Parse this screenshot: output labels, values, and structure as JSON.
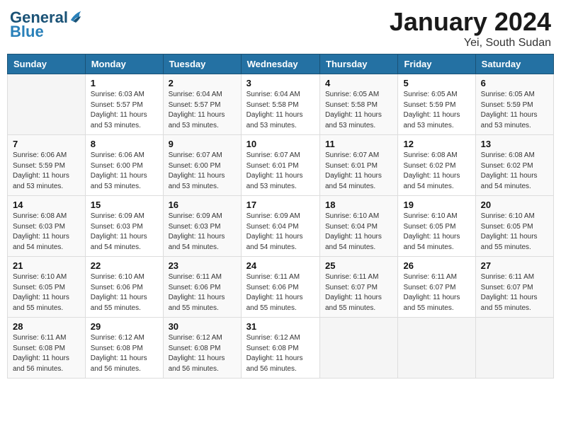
{
  "header": {
    "logo_line1": "General",
    "logo_line2": "Blue",
    "month": "January 2024",
    "location": "Yei, South Sudan"
  },
  "weekdays": [
    "Sunday",
    "Monday",
    "Tuesday",
    "Wednesday",
    "Thursday",
    "Friday",
    "Saturday"
  ],
  "weeks": [
    [
      {
        "day": "",
        "info": ""
      },
      {
        "day": "1",
        "info": "Sunrise: 6:03 AM\nSunset: 5:57 PM\nDaylight: 11 hours\nand 53 minutes."
      },
      {
        "day": "2",
        "info": "Sunrise: 6:04 AM\nSunset: 5:57 PM\nDaylight: 11 hours\nand 53 minutes."
      },
      {
        "day": "3",
        "info": "Sunrise: 6:04 AM\nSunset: 5:58 PM\nDaylight: 11 hours\nand 53 minutes."
      },
      {
        "day": "4",
        "info": "Sunrise: 6:05 AM\nSunset: 5:58 PM\nDaylight: 11 hours\nand 53 minutes."
      },
      {
        "day": "5",
        "info": "Sunrise: 6:05 AM\nSunset: 5:59 PM\nDaylight: 11 hours\nand 53 minutes."
      },
      {
        "day": "6",
        "info": "Sunrise: 6:05 AM\nSunset: 5:59 PM\nDaylight: 11 hours\nand 53 minutes."
      }
    ],
    [
      {
        "day": "7",
        "info": "Sunrise: 6:06 AM\nSunset: 5:59 PM\nDaylight: 11 hours\nand 53 minutes."
      },
      {
        "day": "8",
        "info": "Sunrise: 6:06 AM\nSunset: 6:00 PM\nDaylight: 11 hours\nand 53 minutes."
      },
      {
        "day": "9",
        "info": "Sunrise: 6:07 AM\nSunset: 6:00 PM\nDaylight: 11 hours\nand 53 minutes."
      },
      {
        "day": "10",
        "info": "Sunrise: 6:07 AM\nSunset: 6:01 PM\nDaylight: 11 hours\nand 53 minutes."
      },
      {
        "day": "11",
        "info": "Sunrise: 6:07 AM\nSunset: 6:01 PM\nDaylight: 11 hours\nand 54 minutes."
      },
      {
        "day": "12",
        "info": "Sunrise: 6:08 AM\nSunset: 6:02 PM\nDaylight: 11 hours\nand 54 minutes."
      },
      {
        "day": "13",
        "info": "Sunrise: 6:08 AM\nSunset: 6:02 PM\nDaylight: 11 hours\nand 54 minutes."
      }
    ],
    [
      {
        "day": "14",
        "info": "Sunrise: 6:08 AM\nSunset: 6:03 PM\nDaylight: 11 hours\nand 54 minutes."
      },
      {
        "day": "15",
        "info": "Sunrise: 6:09 AM\nSunset: 6:03 PM\nDaylight: 11 hours\nand 54 minutes."
      },
      {
        "day": "16",
        "info": "Sunrise: 6:09 AM\nSunset: 6:03 PM\nDaylight: 11 hours\nand 54 minutes."
      },
      {
        "day": "17",
        "info": "Sunrise: 6:09 AM\nSunset: 6:04 PM\nDaylight: 11 hours\nand 54 minutes."
      },
      {
        "day": "18",
        "info": "Sunrise: 6:10 AM\nSunset: 6:04 PM\nDaylight: 11 hours\nand 54 minutes."
      },
      {
        "day": "19",
        "info": "Sunrise: 6:10 AM\nSunset: 6:05 PM\nDaylight: 11 hours\nand 54 minutes."
      },
      {
        "day": "20",
        "info": "Sunrise: 6:10 AM\nSunset: 6:05 PM\nDaylight: 11 hours\nand 55 minutes."
      }
    ],
    [
      {
        "day": "21",
        "info": "Sunrise: 6:10 AM\nSunset: 6:05 PM\nDaylight: 11 hours\nand 55 minutes."
      },
      {
        "day": "22",
        "info": "Sunrise: 6:10 AM\nSunset: 6:06 PM\nDaylight: 11 hours\nand 55 minutes."
      },
      {
        "day": "23",
        "info": "Sunrise: 6:11 AM\nSunset: 6:06 PM\nDaylight: 11 hours\nand 55 minutes."
      },
      {
        "day": "24",
        "info": "Sunrise: 6:11 AM\nSunset: 6:06 PM\nDaylight: 11 hours\nand 55 minutes."
      },
      {
        "day": "25",
        "info": "Sunrise: 6:11 AM\nSunset: 6:07 PM\nDaylight: 11 hours\nand 55 minutes."
      },
      {
        "day": "26",
        "info": "Sunrise: 6:11 AM\nSunset: 6:07 PM\nDaylight: 11 hours\nand 55 minutes."
      },
      {
        "day": "27",
        "info": "Sunrise: 6:11 AM\nSunset: 6:07 PM\nDaylight: 11 hours\nand 55 minutes."
      }
    ],
    [
      {
        "day": "28",
        "info": "Sunrise: 6:11 AM\nSunset: 6:08 PM\nDaylight: 11 hours\nand 56 minutes."
      },
      {
        "day": "29",
        "info": "Sunrise: 6:12 AM\nSunset: 6:08 PM\nDaylight: 11 hours\nand 56 minutes."
      },
      {
        "day": "30",
        "info": "Sunrise: 6:12 AM\nSunset: 6:08 PM\nDaylight: 11 hours\nand 56 minutes."
      },
      {
        "day": "31",
        "info": "Sunrise: 6:12 AM\nSunset: 6:08 PM\nDaylight: 11 hours\nand 56 minutes."
      },
      {
        "day": "",
        "info": ""
      },
      {
        "day": "",
        "info": ""
      },
      {
        "day": "",
        "info": ""
      }
    ]
  ]
}
